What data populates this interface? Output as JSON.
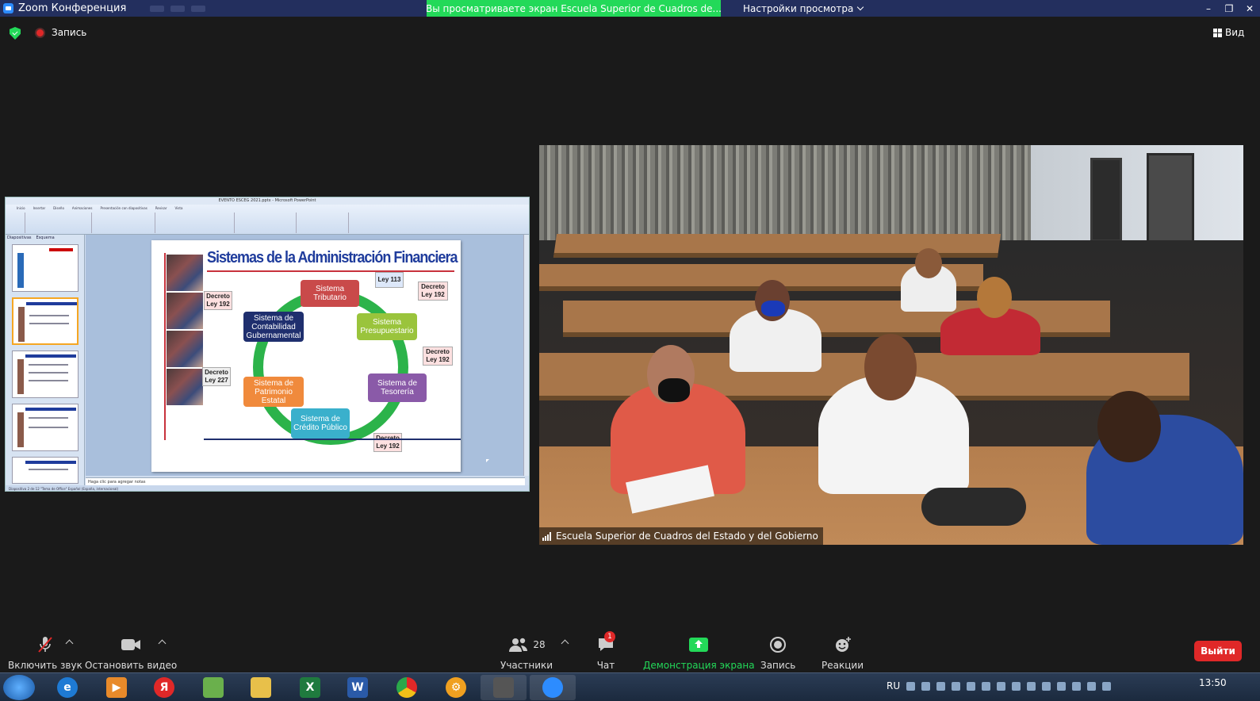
{
  "window": {
    "title": "Zoom Конференция",
    "share_banner": "Вы просматриваете экран Escuela Superior de Cuadros de...",
    "view_options": "Настройки просмотра",
    "controls": [
      "–",
      "❐",
      "✕"
    ]
  },
  "meeting": {
    "record_label": "Запись",
    "view_label": "Вид"
  },
  "shared_screen": {
    "app_title": "EVENTO ESCEG 2021.pptx - Microsoft PowerPoint",
    "ribbon_tabs": [
      "Inicio",
      "Insertar",
      "Diseño",
      "Animaciones",
      "Presentación con diapositivas",
      "Revisar",
      "Vista"
    ],
    "thumb_tabs": [
      "Diapositivas",
      "Esquema"
    ],
    "notes_placeholder": "Haga clic para agregar notas",
    "status": "Diapositiva 2 de 12   \"Tema de Office\"   Español (España, internacional)",
    "slide": {
      "title": "Sistemas de la Administración Financiera del Estado",
      "nodes": {
        "tributario": "Sistema Tributario",
        "presupuestario": "Sistema Presupuestario",
        "tesoreria": "Sistema de Tesorería",
        "credito": "Sistema de Crédito Público",
        "patrimonio": "Sistema de Patrimonio Estatal",
        "contabilidad": "Sistema de Contabilidad Gubernamental"
      },
      "decrees": {
        "ley113": "Ley 113",
        "d1": "Decreto Ley 192",
        "d2": "Decreto Ley 192",
        "d3": "Decreto Ley 192",
        "d4": "Decreto Ley 192",
        "d5": "Decreto Ley 227"
      }
    }
  },
  "video": {
    "participant_name": "Escuela Superior de Cuadros del Estado y del Gobierno"
  },
  "toolbar": {
    "unmute": "Включить звук",
    "stop_video": "Остановить видео",
    "participants": "Участники",
    "participants_count": "28",
    "chat": "Чат",
    "chat_badge": "1",
    "share": "Демонстрация экрана",
    "record": "Запись",
    "reactions": "Реакции",
    "leave": "Выйти"
  },
  "taskbar": {
    "lang": "RU",
    "time": "13:50"
  },
  "colors": {
    "titlebar": "#232f5e",
    "share_green": "#23d959",
    "leave_red": "#e02828",
    "slide_title_blue": "#1f3c9c"
  }
}
